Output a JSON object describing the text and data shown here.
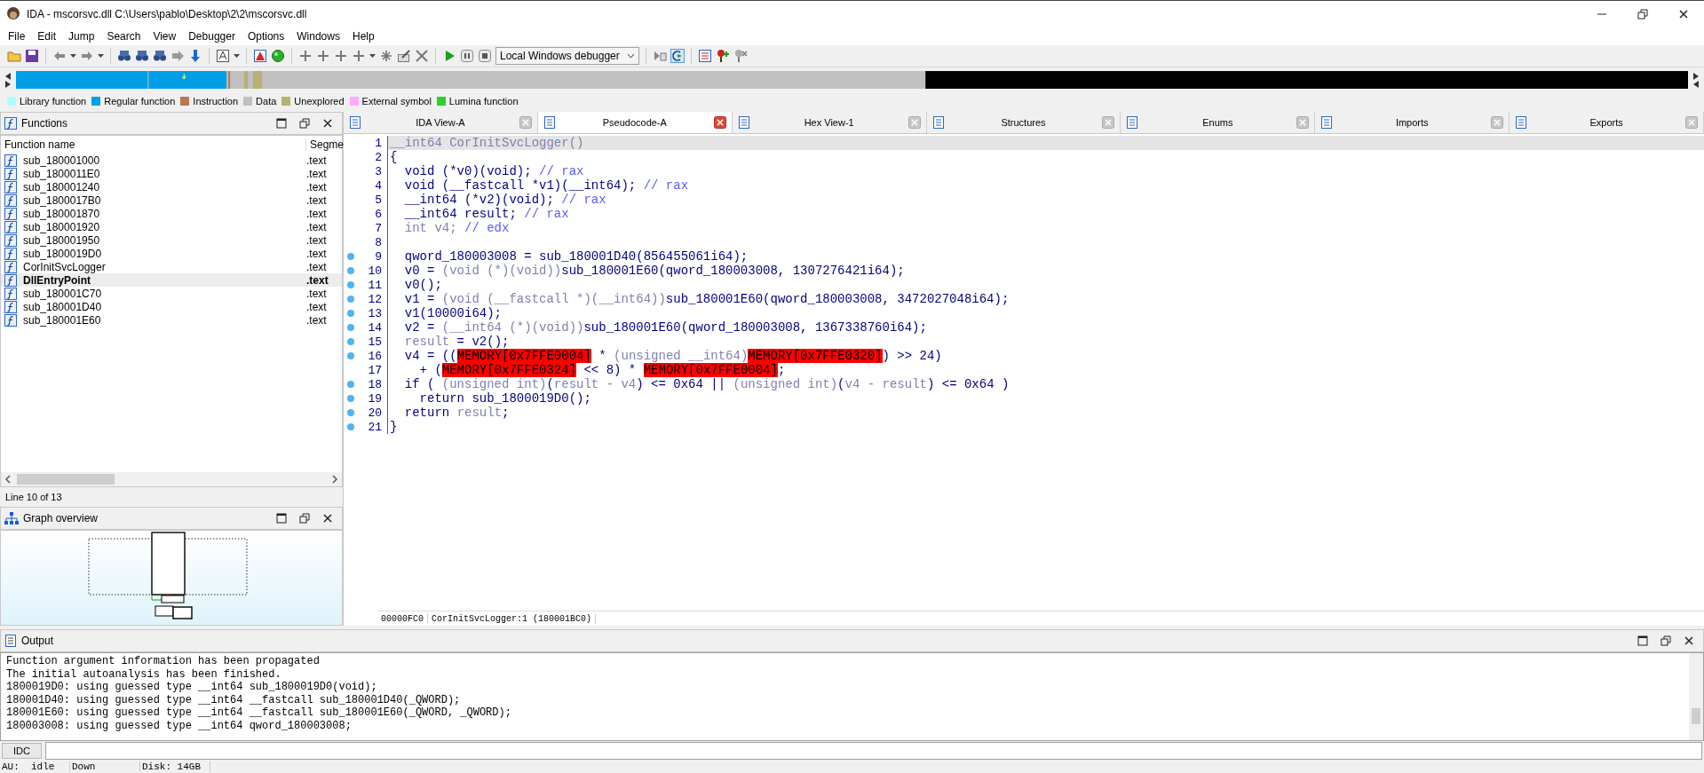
{
  "window": {
    "title": "IDA - mscorsvc.dll C:\\Users\\pablo\\Desktop\\2\\2\\mscorsvc.dll"
  },
  "menu": [
    "File",
    "Edit",
    "Jump",
    "Search",
    "View",
    "Debugger",
    "Options",
    "Windows",
    "Help"
  ],
  "toolbar": {
    "debugger": "Local Windows debugger"
  },
  "legend": [
    {
      "label": "Library function",
      "color": "#aaffff"
    },
    {
      "label": "Regular function",
      "color": "#00a0e8"
    },
    {
      "label": "Instruction",
      "color": "#b87850"
    },
    {
      "label": "Data",
      "color": "#c0c0c0"
    },
    {
      "label": "Unexplored",
      "color": "#b8b070"
    },
    {
      "label": "External symbol",
      "color": "#ffa8ff"
    },
    {
      "label": "Lumina function",
      "color": "#30d030"
    }
  ],
  "functions_panel": {
    "title": "Functions",
    "columns": [
      "Function name",
      "Segme"
    ],
    "rows": [
      {
        "name": "sub_180001000",
        "segment": ".text",
        "selected": false
      },
      {
        "name": "sub_1800011E0",
        "segment": ".text",
        "selected": false
      },
      {
        "name": "sub_180001240",
        "segment": ".text",
        "selected": false
      },
      {
        "name": "sub_1800017B0",
        "segment": ".text",
        "selected": false
      },
      {
        "name": "sub_180001870",
        "segment": ".text",
        "selected": false
      },
      {
        "name": "sub_180001920",
        "segment": ".text",
        "selected": false
      },
      {
        "name": "sub_180001950",
        "segment": ".text",
        "selected": false
      },
      {
        "name": "sub_1800019D0",
        "segment": ".text",
        "selected": false
      },
      {
        "name": "CorInitSvcLogger",
        "segment": ".text",
        "selected": false
      },
      {
        "name": "DllEntryPoint",
        "segment": ".text",
        "selected": true
      },
      {
        "name": "sub_180001C70",
        "segment": ".text",
        "selected": false
      },
      {
        "name": "sub_180001D40",
        "segment": ".text",
        "selected": false
      },
      {
        "name": "sub_180001E60",
        "segment": ".text",
        "selected": false
      }
    ],
    "status": "Line 10 of 13"
  },
  "graph_overview": {
    "title": "Graph overview"
  },
  "tabs": [
    {
      "label": "IDA View-A",
      "selected": false
    },
    {
      "label": "Pseudocode-A",
      "selected": true
    },
    {
      "label": "Hex View-1",
      "selected": false
    },
    {
      "label": "Structures",
      "selected": false
    },
    {
      "label": "Enums",
      "selected": false
    },
    {
      "label": "Imports",
      "selected": false
    },
    {
      "label": "Exports",
      "selected": false
    }
  ],
  "pseudocode": {
    "lines": [
      {
        "number": "1",
        "current": true,
        "breakpoint": false,
        "tokens": [
          {
            "kind": "dim",
            "text": "__int64 CorInitSvcLogger()"
          }
        ]
      },
      {
        "number": "2",
        "current": false,
        "breakpoint": false,
        "tokens": [
          {
            "kind": "code",
            "text": "{"
          }
        ]
      },
      {
        "number": "3",
        "current": false,
        "breakpoint": false,
        "tokens": [
          {
            "kind": "code",
            "text": "  void (*v0)(void); "
          },
          {
            "kind": "comment",
            "text": "// rax"
          }
        ]
      },
      {
        "number": "4",
        "current": false,
        "breakpoint": false,
        "tokens": [
          {
            "kind": "code",
            "text": "  void (__fastcall *v1)(__int64); "
          },
          {
            "kind": "comment",
            "text": "// rax"
          }
        ]
      },
      {
        "number": "5",
        "current": false,
        "breakpoint": false,
        "tokens": [
          {
            "kind": "code",
            "text": "  __int64 (*v2)(void); "
          },
          {
            "kind": "comment",
            "text": "// rax"
          }
        ]
      },
      {
        "number": "6",
        "current": false,
        "breakpoint": false,
        "tokens": [
          {
            "kind": "code",
            "text": "  __int64 result; "
          },
          {
            "kind": "comment",
            "text": "// rax"
          }
        ]
      },
      {
        "number": "7",
        "current": false,
        "breakpoint": false,
        "tokens": [
          {
            "kind": "dim",
            "text": "  int v4; "
          },
          {
            "kind": "comment",
            "text": "// edx"
          }
        ]
      },
      {
        "number": "8",
        "current": false,
        "breakpoint": false
      },
      {
        "number": "9",
        "current": false,
        "breakpoint": true,
        "tokens": [
          {
            "kind": "code",
            "text": "  qword_180003008 = sub_180001D40(856455061i64);"
          }
        ]
      },
      {
        "number": "10",
        "current": false,
        "breakpoint": true,
        "tokens": [
          {
            "kind": "code",
            "text": "  v0 = "
          },
          {
            "kind": "dim",
            "text": "(void (*)(void))"
          },
          {
            "kind": "code",
            "text": "sub_180001E60(qword_180003008, 1307276421i64);"
          }
        ]
      },
      {
        "number": "11",
        "current": false,
        "breakpoint": true,
        "tokens": [
          {
            "kind": "code",
            "text": "  v0();"
          }
        ]
      },
      {
        "number": "12",
        "current": false,
        "breakpoint": true,
        "tokens": [
          {
            "kind": "code",
            "text": "  v1 = "
          },
          {
            "kind": "dim",
            "text": "(void (__fastcall *)(__int64))"
          },
          {
            "kind": "code",
            "text": "sub_180001E60(qword_180003008, 3472027048i64);"
          }
        ]
      },
      {
        "number": "13",
        "current": false,
        "breakpoint": true,
        "tokens": [
          {
            "kind": "code",
            "text": "  v1(10000i64);"
          }
        ]
      },
      {
        "number": "14",
        "current": false,
        "breakpoint": true,
        "tokens": [
          {
            "kind": "code",
            "text": "  v2 = "
          },
          {
            "kind": "dim",
            "text": "(__int64 (*)(void))"
          },
          {
            "kind": "code",
            "text": "sub_180001E60(qword_180003008, 1367338760i64);"
          }
        ]
      },
      {
        "number": "15",
        "current": false,
        "breakpoint": true,
        "tokens": [
          {
            "kind": "dim",
            "text": "  result"
          },
          {
            "kind": "code",
            "text": " = v2();"
          }
        ]
      },
      {
        "number": "16",
        "current": false,
        "breakpoint": true,
        "tokens": [
          {
            "kind": "code",
            "text": "  v4 = (("
          },
          {
            "kind": "highlight",
            "text": "MEMORY[0x7FFE0004]"
          },
          {
            "kind": "code",
            "text": " * "
          },
          {
            "kind": "dim",
            "text": "(unsigned __int64)"
          },
          {
            "kind": "highlight",
            "text": "MEMORY[0x7FFE0320]"
          },
          {
            "kind": "code",
            "text": ") >> 24)"
          }
        ]
      },
      {
        "number": "17",
        "current": false,
        "breakpoint": false,
        "tokens": [
          {
            "kind": "code",
            "text": "    + ("
          },
          {
            "kind": "highlight",
            "text": "MEMORY[0x7FFE0324]"
          },
          {
            "kind": "code",
            "text": " << 8) * "
          },
          {
            "kind": "highlight",
            "text": "MEMORY[0x7FFE0004]"
          },
          {
            "kind": "code",
            "text": ";"
          }
        ]
      },
      {
        "number": "18",
        "current": false,
        "breakpoint": true,
        "tokens": [
          {
            "kind": "code",
            "text": "  if ( "
          },
          {
            "kind": "dim",
            "text": "(unsigned int)"
          },
          {
            "kind": "code",
            "text": "("
          },
          {
            "kind": "dim",
            "text": "result - v4"
          },
          {
            "kind": "code",
            "text": ") <= 0x64 || "
          },
          {
            "kind": "dim",
            "text": "(unsigned int)"
          },
          {
            "kind": "code",
            "text": "("
          },
          {
            "kind": "dim",
            "text": "v4 - result"
          },
          {
            "kind": "code",
            "text": ") <= 0x64 )"
          }
        ]
      },
      {
        "number": "19",
        "current": false,
        "breakpoint": true,
        "tokens": [
          {
            "kind": "code",
            "text": "    return sub_1800019D0();"
          }
        ]
      },
      {
        "number": "20",
        "current": false,
        "breakpoint": true,
        "tokens": [
          {
            "kind": "code",
            "text": "  return "
          },
          {
            "kind": "dim",
            "text": "result"
          },
          {
            "kind": "code",
            "text": ";"
          }
        ]
      },
      {
        "number": "21",
        "current": false,
        "breakpoint": true,
        "tokens": [
          {
            "kind": "code",
            "text": "}"
          }
        ]
      }
    ],
    "location": "00000FC0",
    "context": "CorInitSvcLogger:1 (180001BC0)"
  },
  "output": {
    "title": "Output",
    "lines": [
      "Function argument information has been propagated",
      "The initial autoanalysis has been finished.",
      "1800019D0: using guessed type __int64 sub_1800019D0(void);",
      "180001D40: using guessed type __int64 __fastcall sub_180001D40(_QWORD);",
      "180001E60: using guessed type __int64 __fastcall sub_180001E60(_QWORD, _QWORD);",
      "180003008: using guessed type __int64 qword_180003008;"
    ]
  },
  "command": {
    "button": "IDC"
  },
  "status_bar": [
    "AU:  idle",
    "Down",
    "Disk: 14GB"
  ]
}
